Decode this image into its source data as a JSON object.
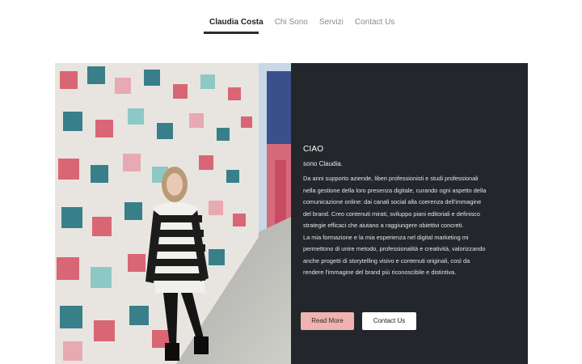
{
  "nav": {
    "items": [
      {
        "label": "Claudia Costa",
        "active": true
      },
      {
        "label": "Chi Sono",
        "active": false
      },
      {
        "label": "Servizi",
        "active": false
      },
      {
        "label": "Contact Us",
        "active": false
      }
    ]
  },
  "hero": {
    "title": "CIAO",
    "greeting": "sono Claudia.",
    "paragraph_1": "Da anni supporto aziende, liberi professionisti e studi professionali nella gestione della loro presenza digitale, curando ogni aspetto della comunicazione online: dai canali social alla coerenza dell'immagine del brand.  Creo contenuti mirati, sviluppo piani editoriali e definisco strategie efficaci che aiutano a raggiungere obiettivi concreti.",
    "paragraph_2": "La mia formazione e la mia esperienza nel digital marketing mi permettono di unire metodo, professionalità e creatività, valorizzando anche progetti di storytelling visivo e contenuti originali, così da rendere l'immagine del brand più riconoscibile e distintiva.",
    "read_more_label": "Read More",
    "contact_label": "Contact Us"
  },
  "colors": {
    "panel_bg": "#23272c",
    "read_more_bg": "#efb3b0",
    "nav_active": "#222222"
  }
}
